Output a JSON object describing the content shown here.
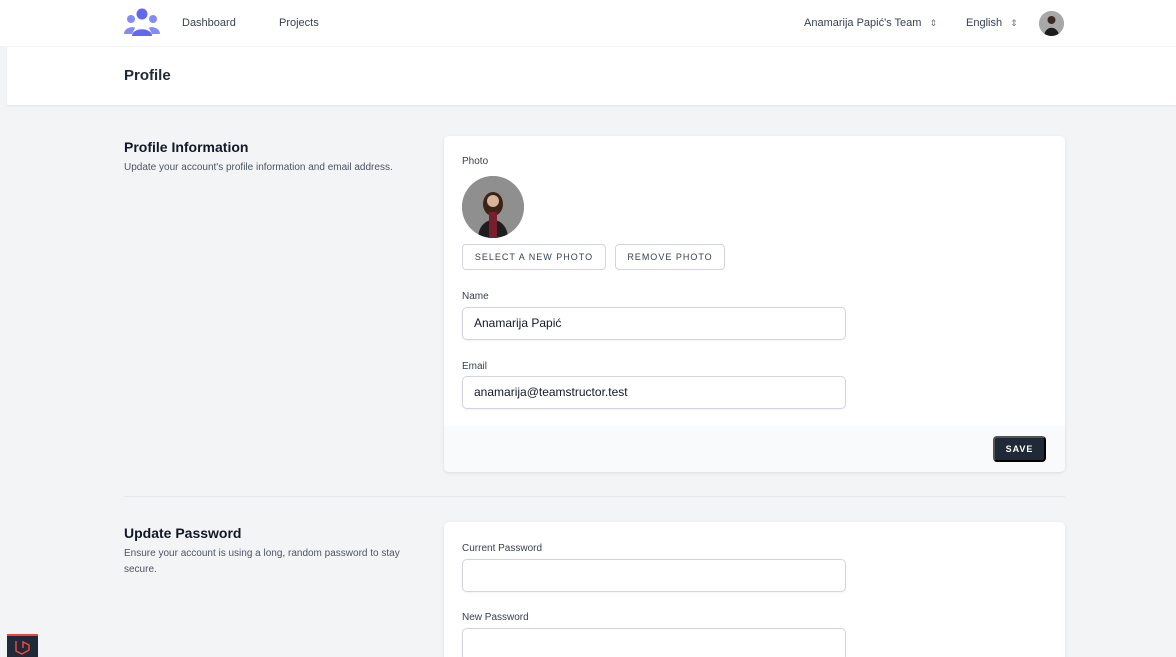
{
  "nav": {
    "links": [
      "Dashboard",
      "Projects"
    ],
    "team_label": "Anamarija Papić's Team",
    "language_label": "English"
  },
  "header": {
    "title": "Profile"
  },
  "profile_info": {
    "title": "Profile Information",
    "description": "Update your account's profile information and email address.",
    "photo_label": "Photo",
    "select_photo_label": "SELECT A NEW PHOTO",
    "remove_photo_label": "REMOVE PHOTO",
    "name_label": "Name",
    "name_value": "Anamarija Papić",
    "email_label": "Email",
    "email_value": "anamarija@teamstructor.test",
    "save_label": "SAVE"
  },
  "update_password": {
    "title": "Update Password",
    "description": "Ensure your account is using a long, random password to stay secure.",
    "current_label": "Current Password",
    "current_value": "",
    "new_label": "New Password",
    "new_value": ""
  },
  "colors": {
    "accent": "#6366f1",
    "primary_button": "#1f2937",
    "background": "#f3f4f6"
  }
}
